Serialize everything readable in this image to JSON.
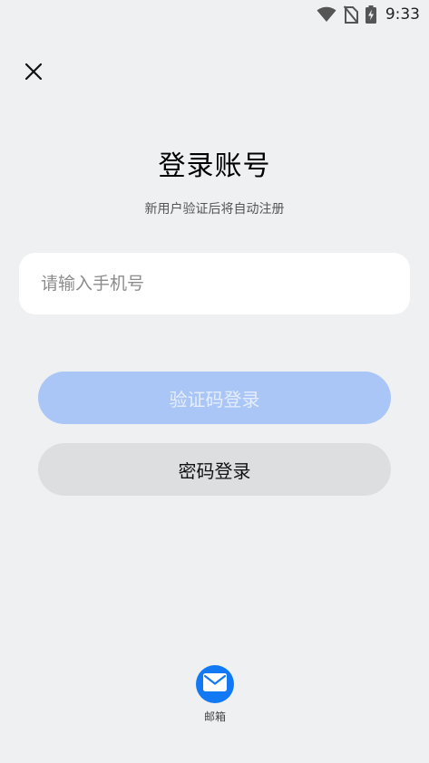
{
  "status_bar": {
    "time": "9:33",
    "icons": [
      "wifi-icon",
      "no-sim-icon",
      "battery-charging-icon"
    ]
  },
  "header": {
    "close_icon": "close-icon"
  },
  "main": {
    "title": "登录账号",
    "subtitle": "新用户验证后将自动注册",
    "phone_input": {
      "value": "",
      "placeholder": "请输入手机号"
    },
    "code_login_label": "验证码登录",
    "password_login_label": "密码登录"
  },
  "footer": {
    "email_label": "邮箱",
    "email_icon": "mail-icon"
  },
  "colors": {
    "background": "#eff0f2",
    "primary_disabled": "#a9c6f6",
    "secondary_button": "#dddee0",
    "email_accent": "#1279f5"
  }
}
